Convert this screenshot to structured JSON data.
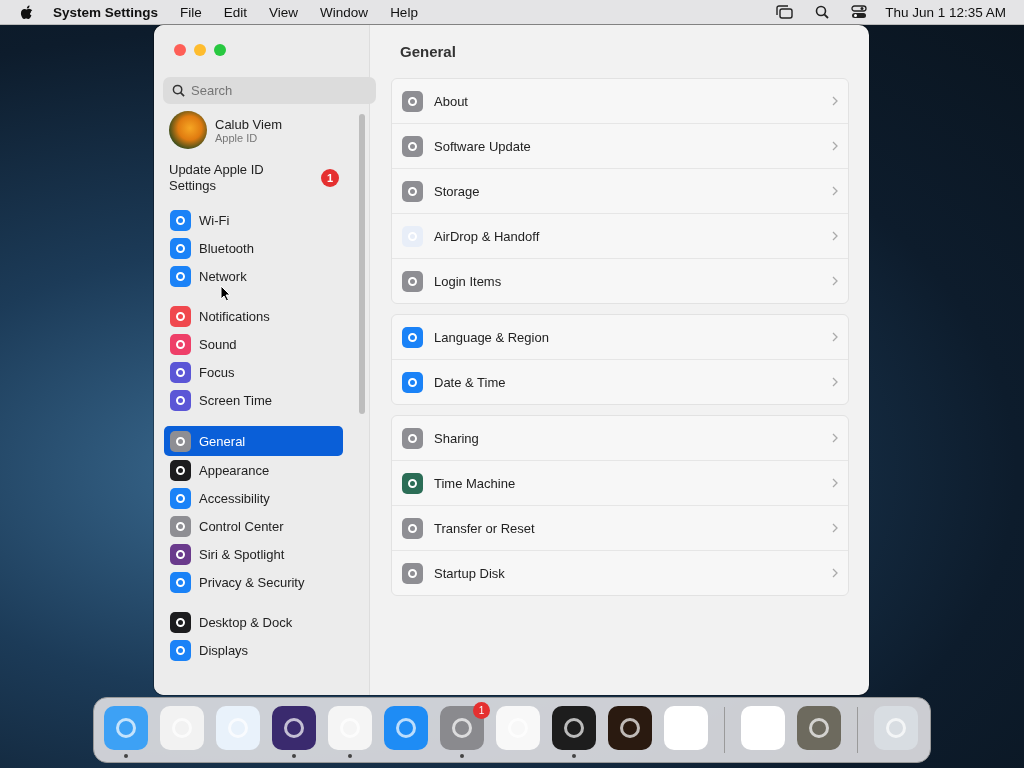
{
  "menu_bar": {
    "app_name": "System Settings",
    "menus": [
      "File",
      "Edit",
      "View",
      "Window",
      "Help"
    ],
    "clock": "Thu Jun 1  12:35 AM"
  },
  "window": {
    "search": {
      "placeholder": "Search"
    },
    "account": {
      "name": "Calub Viem",
      "subtitle": "Apple ID"
    },
    "update_notice": {
      "text": "Update Apple ID Settings",
      "badge": "1"
    },
    "sidebar_groups": [
      [
        {
          "label": "Wi-Fi",
          "selected": false
        },
        {
          "label": "Bluetooth",
          "selected": false
        },
        {
          "label": "Network",
          "selected": false
        }
      ],
      [
        {
          "label": "Notifications",
          "selected": false
        },
        {
          "label": "Sound",
          "selected": false
        },
        {
          "label": "Focus",
          "selected": false
        },
        {
          "label": "Screen Time",
          "selected": false
        }
      ],
      [
        {
          "label": "General",
          "selected": true
        },
        {
          "label": "Appearance",
          "selected": false
        },
        {
          "label": "Accessibility",
          "selected": false
        },
        {
          "label": "Control Center",
          "selected": false
        },
        {
          "label": "Siri & Spotlight",
          "selected": false
        },
        {
          "label": "Privacy & Security",
          "selected": false
        }
      ],
      [
        {
          "label": "Desktop & Dock",
          "selected": false
        },
        {
          "label": "Displays",
          "selected": false
        }
      ]
    ],
    "pane_title": "General",
    "settings_groups": [
      [
        "About",
        "Software Update",
        "Storage",
        "AirDrop & Handoff",
        "Login Items"
      ],
      [
        "Language & Region",
        "Date & Time"
      ],
      [
        "Sharing",
        "Time Machine",
        "Transfer or Reset",
        "Startup Disk"
      ]
    ]
  },
  "dock": {
    "groups": [
      [
        {
          "running": true
        },
        {
          "running": false
        },
        {
          "running": false
        },
        {
          "running": true
        },
        {
          "running": true
        },
        {
          "running": false
        },
        {
          "running": true,
          "badge": "1"
        },
        {
          "running": false
        },
        {
          "running": true
        },
        {
          "running": false
        },
        {
          "running": false
        }
      ],
      [
        {
          "running": false
        },
        {
          "running": false
        }
      ],
      [
        {
          "running": false
        }
      ]
    ]
  }
}
